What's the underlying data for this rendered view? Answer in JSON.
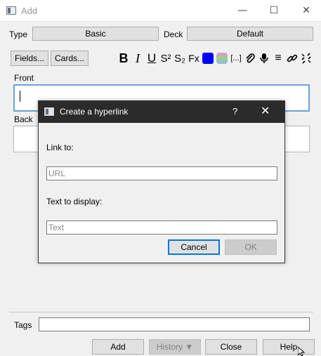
{
  "window": {
    "title": "Add"
  },
  "window_controls": [
    "minimize-icon",
    "maximize-icon",
    "close-icon"
  ],
  "selectors": {
    "type_label": "Type",
    "type_value": "Basic",
    "deck_label": "Deck",
    "deck_value": "Default"
  },
  "toolbar": {
    "fields_button": "Fields...",
    "cards_button": "Cards...",
    "format_buttons": [
      {
        "name": "bold-icon",
        "glyph": "B"
      },
      {
        "name": "italic-icon",
        "glyph": "I"
      },
      {
        "name": "underline-icon",
        "glyph": "U"
      },
      {
        "name": "superscript-icon",
        "glyph": "S²"
      },
      {
        "name": "subscript-icon",
        "glyph": "S₂"
      },
      {
        "name": "clear-format-icon",
        "glyph": "Fx"
      },
      {
        "name": "text-color-icon",
        "glyph": ""
      },
      {
        "name": "highlight-color-icon",
        "glyph": ""
      },
      {
        "name": "cloze-icon",
        "glyph": "[...]"
      },
      {
        "name": "attach-icon",
        "glyph": ""
      },
      {
        "name": "record-audio-icon",
        "glyph": ""
      },
      {
        "name": "more-menu-icon",
        "glyph": "≡"
      },
      {
        "name": "link-icon",
        "glyph": ""
      },
      {
        "name": "unlink-icon",
        "glyph": ""
      }
    ],
    "text_color": "#0000ff"
  },
  "fields": {
    "front_label": "Front",
    "back_label": "Back"
  },
  "tags": {
    "label": "Tags"
  },
  "bottom_buttons": {
    "add": "Add",
    "history": "History ▼",
    "close": "Close",
    "help": "Help"
  },
  "dialog": {
    "title": "Create a hyperlink",
    "help": "?",
    "link_label": "Link to:",
    "url_placeholder": "URL",
    "text_label": "Text to display:",
    "text_placeholder": "Text",
    "cancel": "Cancel",
    "ok": "OK"
  },
  "colors": {
    "focus_border": "#0078d7",
    "dialog_titlebar": "#2b2b2b"
  }
}
